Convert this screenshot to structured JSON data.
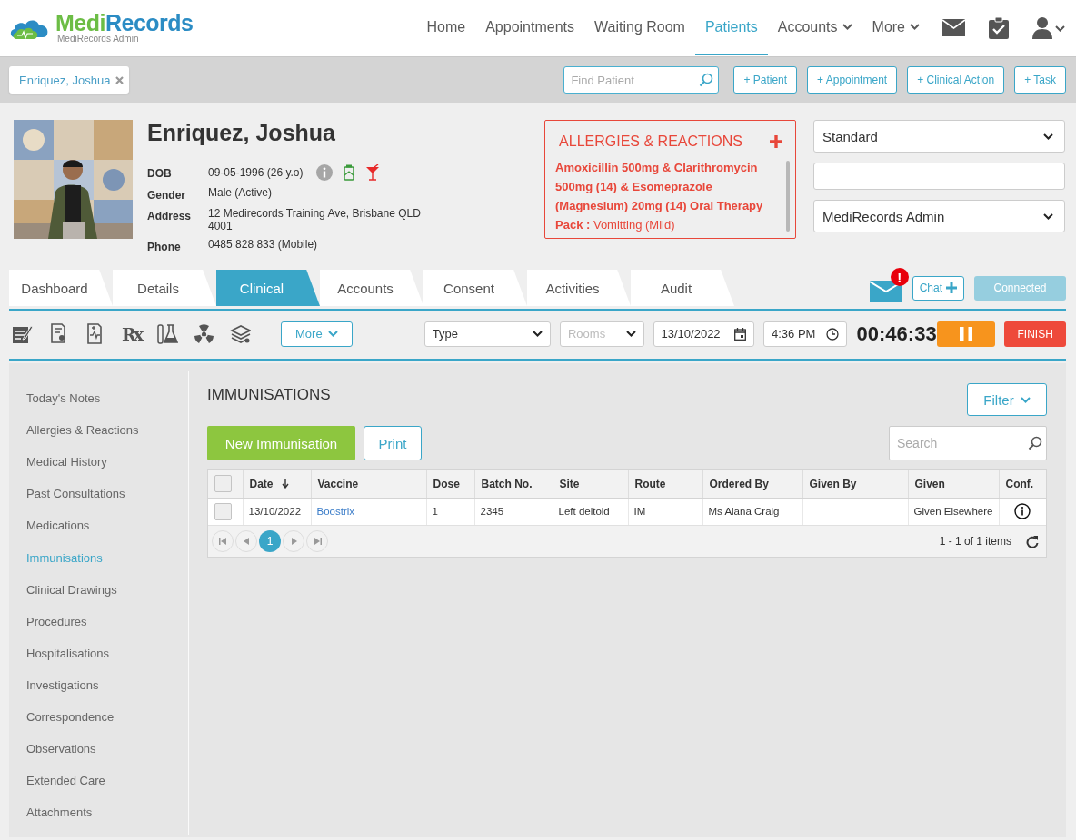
{
  "header": {
    "logo_parts": [
      "Medi",
      "Records"
    ],
    "logo_subtitle": "MediRecords Admin",
    "nav": [
      {
        "label": "Home",
        "selected": false,
        "dropdown": false
      },
      {
        "label": "Appointments",
        "selected": false,
        "dropdown": false
      },
      {
        "label": "Waiting Room",
        "selected": false,
        "dropdown": false
      },
      {
        "label": "Patients",
        "selected": true,
        "dropdown": false
      },
      {
        "label": "Accounts",
        "selected": false,
        "dropdown": true
      },
      {
        "label": "More",
        "selected": false,
        "dropdown": true
      }
    ]
  },
  "patient_bar": {
    "open_patients": [
      {
        "label": "Enriquez, Joshua"
      }
    ],
    "find_patient": {
      "placeholder": "Find Patient"
    },
    "buttons": [
      "+ Patient",
      "+ Appointment",
      "+ Clinical Action",
      "+ Task"
    ]
  },
  "patient": {
    "name": "Enriquez, Joshua",
    "fields": [
      {
        "label": "DOB",
        "value": "09-05-1996 (26 y.o)"
      },
      {
        "label": "Gender",
        "value": "Male (Active)"
      },
      {
        "label": "Address",
        "value": "12 Medirecords Training Ave, Brisbane QLD 4001"
      },
      {
        "label": "Phone",
        "value": "0485 828 833 (Mobile)"
      }
    ]
  },
  "allergies": {
    "title": "ALLERGIES & REACTIONS",
    "entries": [
      "**Amoxicillin 500mg & Clarithromycin 500mg (14) & Esomeprazole (Magnesium) 20mg (14) Oral Therapy Pack :** Vomitting (Mild)"
    ]
  },
  "selectors": [
    {
      "kind": "select",
      "value": "Standard"
    },
    {
      "kind": "input"
    },
    {
      "kind": "select",
      "value": "MediRecords Admin"
    }
  ],
  "tabs": [
    {
      "label": "Dashboard",
      "selected": false
    },
    {
      "label": "Details",
      "selected": false
    },
    {
      "label": "Clinical",
      "selected": true
    },
    {
      "label": "Accounts",
      "selected": false
    },
    {
      "label": "Consent",
      "selected": false
    },
    {
      "label": "Activities",
      "selected": false
    },
    {
      "label": "Audit",
      "selected": false
    }
  ],
  "messages": {
    "alert_badge": "!"
  },
  "chat_button": "Chat",
  "connection": {
    "label": "Connected",
    "disabled": true
  },
  "toolbar": {
    "rx_label": "Rx",
    "more_button": "More",
    "type_select": {
      "value": "Type"
    },
    "rooms_select": {
      "placeholder": "Rooms"
    },
    "date": "13/10/2022",
    "time": "4:36 PM",
    "timer": "00:46:33",
    "finish_button": "FINISH"
  },
  "sidebar": {
    "items": [
      {
        "label": "Today's Notes",
        "selected": false
      },
      {
        "label": "Allergies & Reactions",
        "selected": false
      },
      {
        "label": "Medical History",
        "selected": false
      },
      {
        "label": "Past Consultations",
        "selected": false
      },
      {
        "label": "Medications",
        "selected": false
      },
      {
        "label": "Immunisations",
        "selected": true
      },
      {
        "label": "Clinical Drawings",
        "selected": false
      },
      {
        "label": "Procedures",
        "selected": false
      },
      {
        "label": "Hospitalisations",
        "selected": false
      },
      {
        "label": "Investigations",
        "selected": false
      },
      {
        "label": "Correspondence",
        "selected": false
      },
      {
        "label": "Observations",
        "selected": false
      },
      {
        "label": "Extended Care",
        "selected": false
      },
      {
        "label": "Attachments",
        "selected": false
      }
    ]
  },
  "section": {
    "title": "IMMUNISATIONS",
    "filter_button": "Filter",
    "new_button": "New Immunisation",
    "print_button": "Print",
    "search": {
      "placeholder": "Search"
    }
  },
  "table": {
    "all_checked": false,
    "columns": [
      {
        "label": "Date",
        "sorted": true
      },
      {
        "label": "Vaccine",
        "sorted": false
      },
      {
        "label": "Dose",
        "sorted": false
      },
      {
        "label": "Batch No.",
        "sorted": false
      },
      {
        "label": "Site",
        "sorted": false
      },
      {
        "label": "Route",
        "sorted": false
      },
      {
        "label": "Ordered By",
        "sorted": false
      },
      {
        "label": "Given By",
        "sorted": false
      },
      {
        "label": "Given",
        "sorted": false
      },
      {
        "label": "Conf.",
        "sorted": false
      }
    ],
    "rows": [
      {
        "checked": false,
        "cells": [
          {
            "kind": "text",
            "text": "13/10/2022"
          },
          {
            "kind": "link",
            "text": "Boostrix"
          },
          {
            "kind": "text",
            "text": "1"
          },
          {
            "kind": "text",
            "text": "2345"
          },
          {
            "kind": "text",
            "text": "Left deltoid"
          },
          {
            "kind": "text",
            "text": "IM"
          },
          {
            "kind": "text",
            "text": "Ms Alana Craig"
          },
          {
            "kind": "blank"
          },
          {
            "kind": "text",
            "text": "Given Elsewhere"
          },
          {
            "kind": "info"
          }
        ]
      }
    ],
    "pages": [
      {
        "label": "1",
        "selected": true
      }
    ],
    "summary": "1 - 1 of 1 items"
  }
}
